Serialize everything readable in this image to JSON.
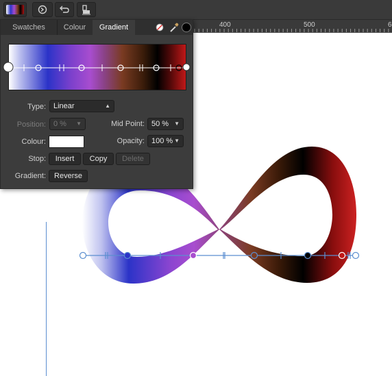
{
  "ruler": {
    "labels": [
      "400",
      "500",
      "6"
    ]
  },
  "panel": {
    "tabs": [
      "Swatches",
      "Colour",
      "Gradient"
    ],
    "active_tab": "Gradient",
    "type_label": "Type:",
    "type_value": "Linear",
    "position_label": "Position:",
    "position_value": "0 %",
    "midpoint_label": "Mid Point:",
    "midpoint_value": "50 %",
    "colour_label": "Colour:",
    "colour_value": "#ffffff",
    "opacity_label": "Opacity:",
    "opacity_value": "100 %",
    "stop_label": "Stop:",
    "insert_label": "Insert",
    "copy_label": "Copy",
    "delete_label": "Delete",
    "gradient_label": "Gradient:",
    "reverse_label": "Reverse"
  },
  "colors": {
    "guide": "#5b8ed0",
    "gradient_stops": [
      "#ffffff",
      "#2b33c8",
      "#a84dcf",
      "#7a3b22",
      "#000000",
      "#c01818"
    ]
  },
  "icons": [
    "gradient-swatch-icon",
    "sync-icon",
    "undo-icon",
    "lock-icon",
    "none-color-icon",
    "color-picker-icon"
  ]
}
